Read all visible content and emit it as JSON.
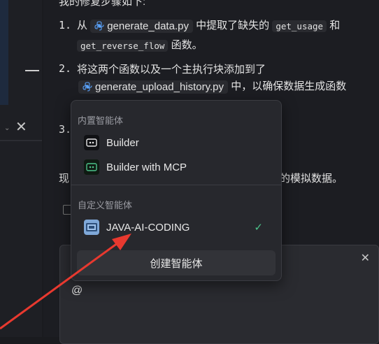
{
  "content": {
    "header_text": "我的修复步骤如下:",
    "step1": {
      "num": "1.",
      "from": "从",
      "file": "generate_data.py",
      "mid": "中提取了缺失的",
      "func1": "get_usage",
      "and": "和",
      "func2": "get_reverse_flow",
      "tail": "函数。"
    },
    "step2": {
      "num": "2.",
      "text": "将这两个函数以及一个主执行块添加到了",
      "file": "generate_upload_history.py",
      "tail": "中，以确保数据生成函数"
    },
    "step3": {
      "num": "3."
    },
    "now_prefix": "现",
    "now_suffix": "的模拟数据。"
  },
  "menu": {
    "section_builtin": "内置智能体",
    "builtin_items": [
      {
        "label": "Builder",
        "icon": "builder-icon"
      },
      {
        "label": "Builder with MCP",
        "icon": "builder-mcp-icon"
      }
    ],
    "section_custom": "自定义智能体",
    "custom_items": [
      {
        "label": "JAVA-AI-CODING",
        "icon": "java-agent-icon",
        "selected": true
      }
    ],
    "create_button": "创建智能体"
  },
  "input": {
    "value": "@"
  },
  "colors": {
    "accent_check": "#4cc38a",
    "arrow": "#e8392f"
  }
}
